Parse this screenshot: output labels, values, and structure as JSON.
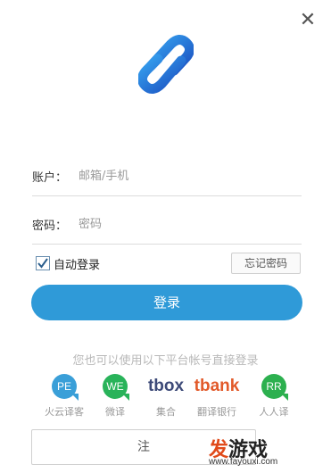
{
  "window": {
    "close_icon": "close-icon",
    "close_glyph": "✕"
  },
  "logo": {
    "icon": "link-logo",
    "colors": [
      "#2b8be0",
      "#1d5fc4"
    ]
  },
  "form": {
    "account_label": "账户：",
    "account_placeholder": "邮箱/手机",
    "password_label": "密码：",
    "password_placeholder": "密码",
    "remember_label": "自动登录",
    "remember_checked": true,
    "forgot_label": "忘记密码",
    "login_label": "登录"
  },
  "alt_login": {
    "prompt": "您也可以使用以下平台帐号直接登录",
    "providers": [
      {
        "mark": "PE",
        "name": "火云译客",
        "color": "#3a9fd8"
      },
      {
        "mark": "WE",
        "name": "微译",
        "color": "#29b35a"
      },
      {
        "mark": "tbox",
        "name": "集合",
        "color": "#3d4a78"
      },
      {
        "mark": "tbank",
        "name": "翻译银行",
        "color": "#e25a2a"
      },
      {
        "mark": "RR",
        "name": "人人译",
        "color": "#2cb04f"
      }
    ]
  },
  "register_label": "注",
  "watermark": {
    "text_a": "发",
    "text_b": "游戏",
    "url": "www.fayouxi.com"
  },
  "colors": {
    "accent": "#2f9ad8"
  }
}
